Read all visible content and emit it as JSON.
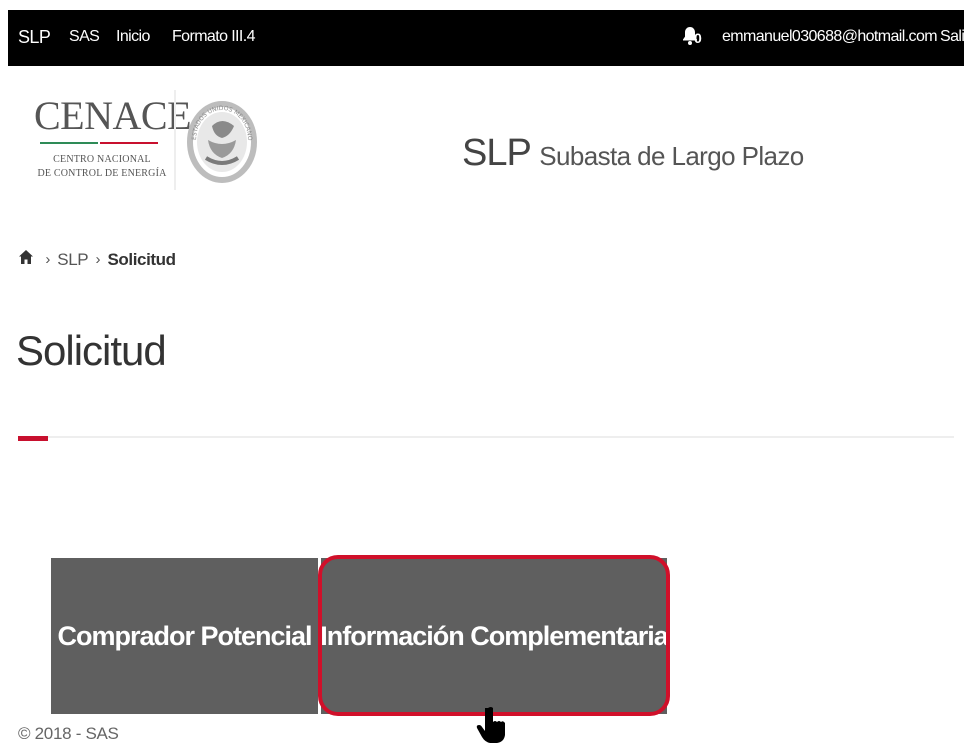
{
  "topbar": {
    "brand": "SLP",
    "links": [
      "SAS",
      "Inicio",
      "Formato III.4"
    ],
    "notification_count": "0",
    "user_email": "emmanuel030688@hotmail.com",
    "logout": "Salir",
    "bell_icon": "bell-icon"
  },
  "header": {
    "logo": {
      "name": "CENACE",
      "line1": "CENTRO NACIONAL",
      "line2": "DE CONTROL DE ENERGÍA"
    },
    "seal_text": "ESTADOS UNIDOS MEXICANOS",
    "app_abbr": "SLP",
    "app_name": "Subasta de Largo Plazo"
  },
  "breadcrumb": {
    "home_icon": "home-icon",
    "items": [
      "SLP",
      "Solicitud"
    ]
  },
  "page": {
    "title": "Solicitud"
  },
  "tiles": [
    {
      "label": "Comprador Potencial"
    },
    {
      "label": "Información Complementaria"
    }
  ],
  "footer": {
    "text": "© 2018 - SAS"
  },
  "colors": {
    "topbar_bg": "#000000",
    "tile_bg": "#5f5f5f",
    "accent_red": "#c8102e",
    "highlight_border": "#d0102a"
  }
}
